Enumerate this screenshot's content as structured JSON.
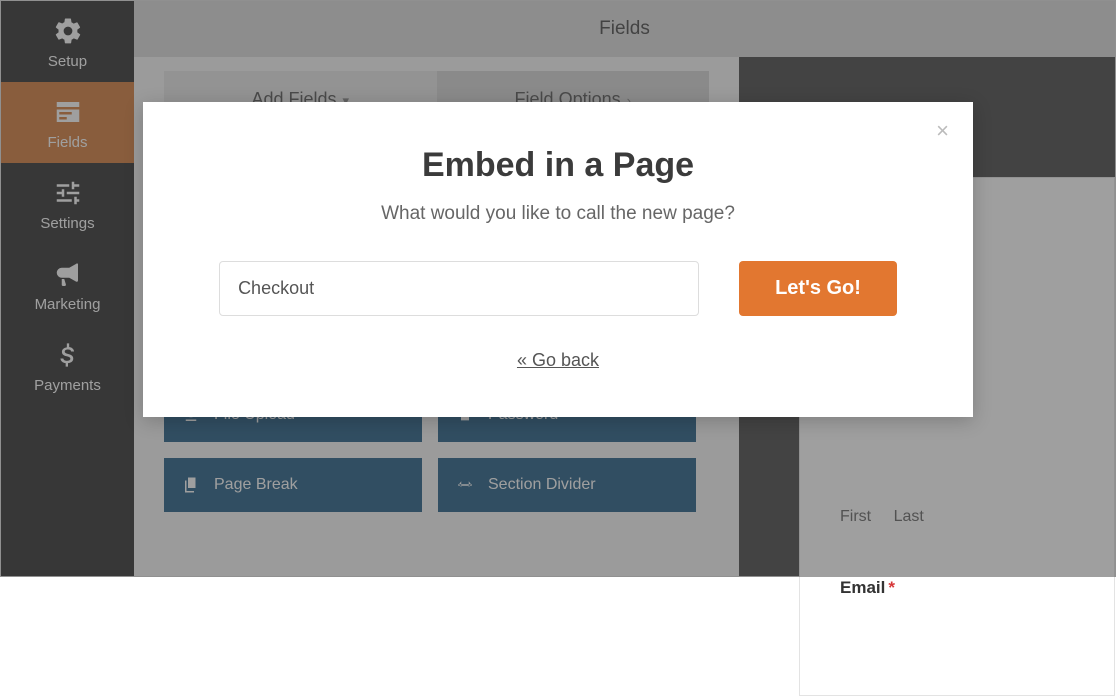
{
  "sidebar": {
    "items": [
      {
        "label": "Setup"
      },
      {
        "label": "Fields"
      },
      {
        "label": "Settings"
      },
      {
        "label": "Marketing"
      },
      {
        "label": "Payments"
      }
    ]
  },
  "header": {
    "title": "Fields"
  },
  "tabs": {
    "add": "Add Fields",
    "options": "Field Options"
  },
  "field_cards": {
    "file_upload": "File Upload",
    "password": "Password",
    "page_break": "Page Break",
    "section_divider": "Section Divider"
  },
  "preview": {
    "first": "First",
    "last": "Last",
    "email": "Email",
    "required_mark": "*"
  },
  "modal": {
    "title": "Embed in a Page",
    "subtitle": "What would you like to call the new page?",
    "input_value": "Checkout",
    "button": "Let's Go!",
    "back": "« Go back",
    "close": "×"
  }
}
